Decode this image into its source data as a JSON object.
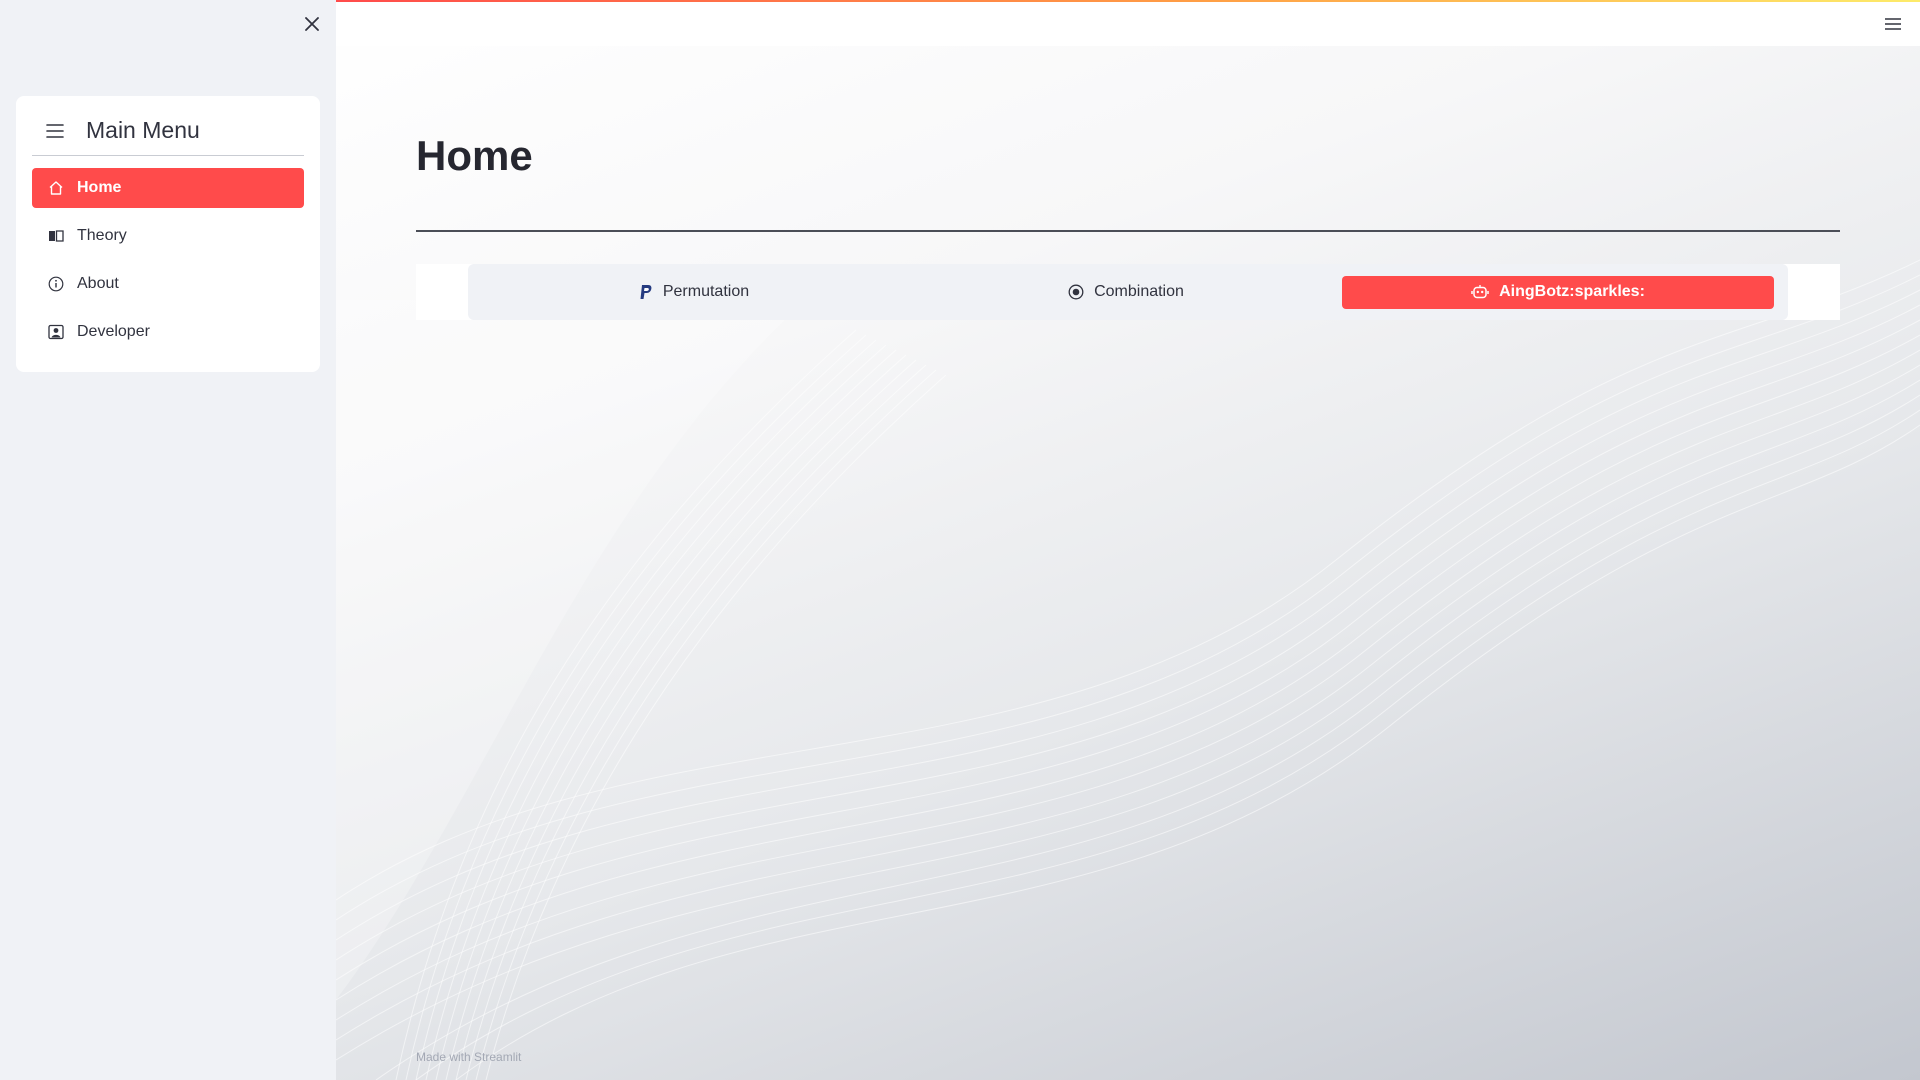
{
  "sidebar": {
    "menu_title": "Main Menu",
    "items": [
      {
        "label": "Home",
        "icon": "house-icon",
        "active": true
      },
      {
        "label": "Theory",
        "icon": "book-icon",
        "active": false
      },
      {
        "label": "About",
        "icon": "info-circle-icon",
        "active": false
      },
      {
        "label": "Developer",
        "icon": "person-badge-icon",
        "active": false
      }
    ]
  },
  "main": {
    "title": "Home",
    "tabs": [
      {
        "label": "Permutation",
        "icon": "paypal-icon",
        "active": false
      },
      {
        "label": "Combination",
        "icon": "record-circle-icon",
        "active": false
      },
      {
        "label": "AingBotz:sparkles:",
        "icon": "robot-icon",
        "active": true
      }
    ],
    "footer": "Made with Streamlit"
  },
  "colors": {
    "accent": "#ff4b4b",
    "sidebar_bg": "#f0f2f6",
    "text": "#31333f"
  }
}
